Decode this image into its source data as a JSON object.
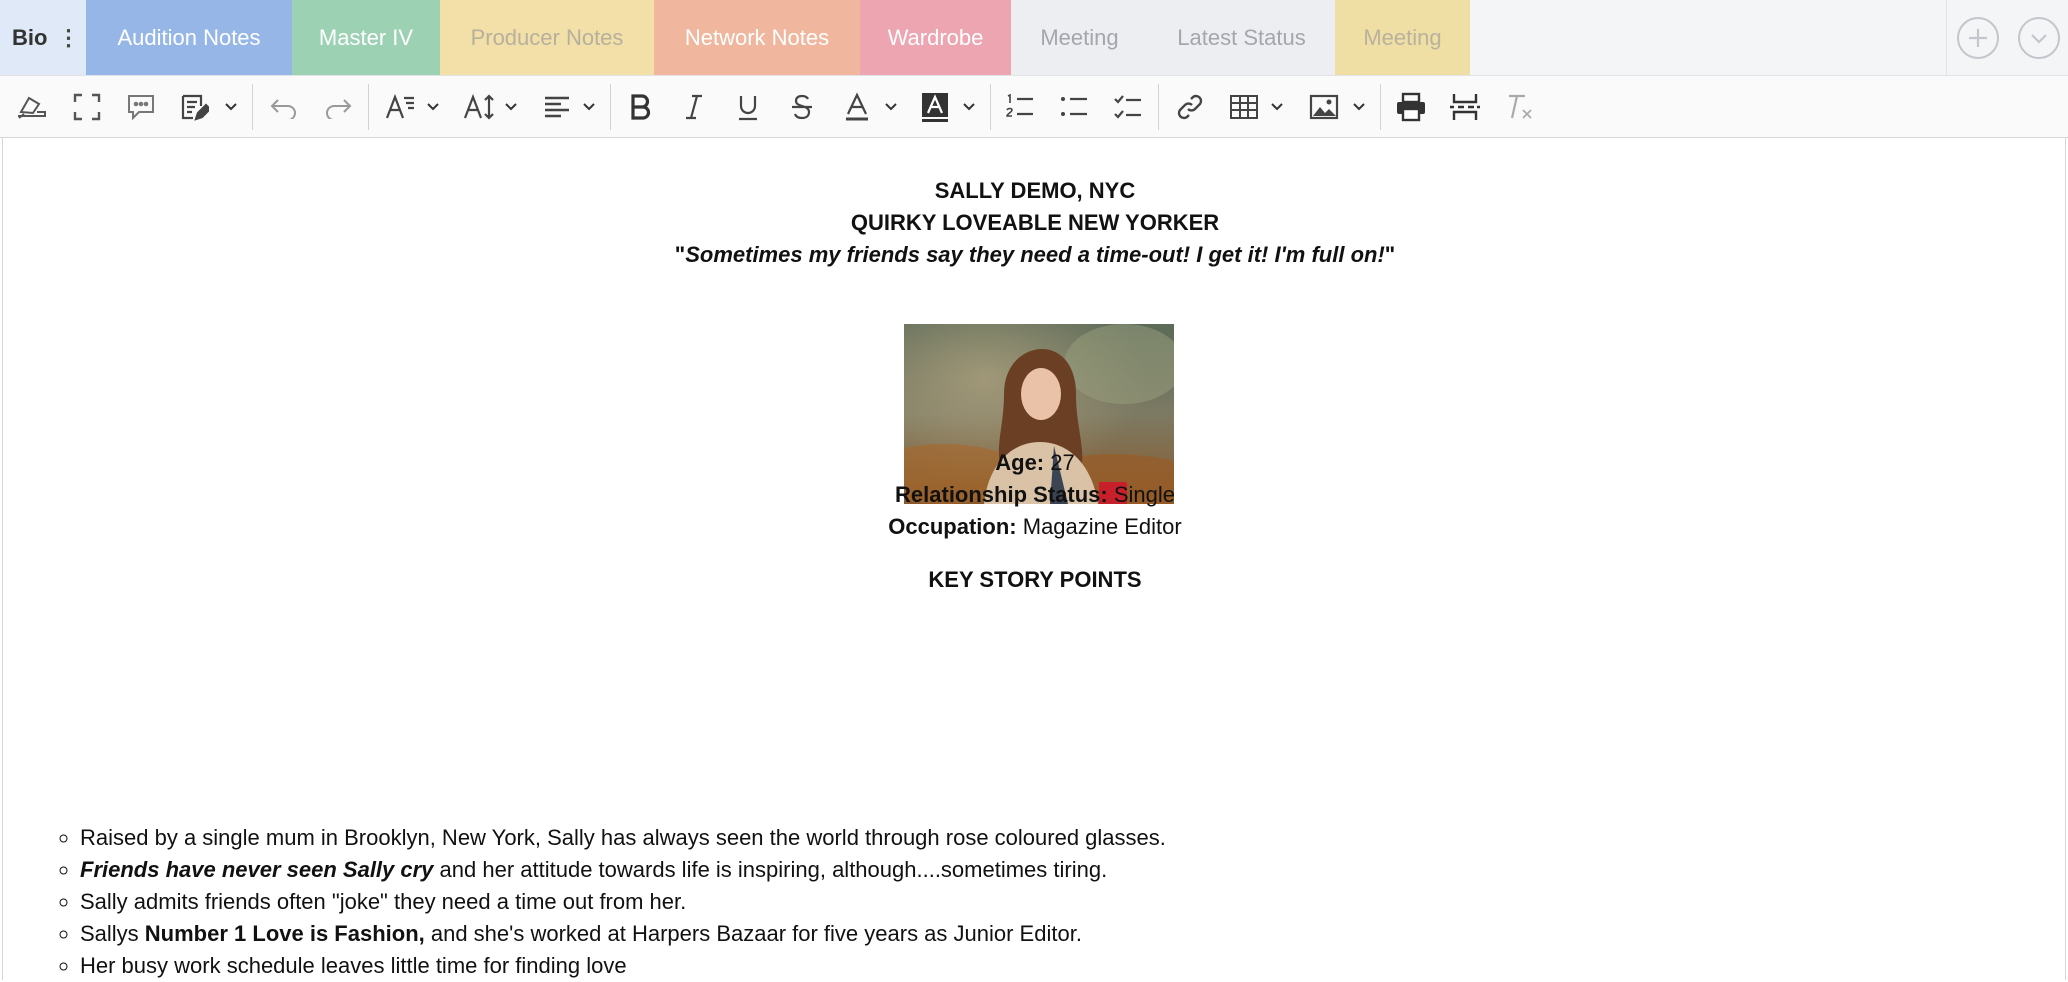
{
  "tabs": {
    "bio": "Bio",
    "bio_menu": "⋮",
    "items": [
      "Audition Notes",
      "Master IV",
      "Producer Notes",
      "Network Notes",
      "Wardrobe",
      "Meeting",
      "Latest Status",
      "Meeting"
    ]
  },
  "toolbar": {
    "icons": [
      "format-painter-icon",
      "fullscreen-icon",
      "comment-icon",
      "edit-mode-icon",
      "undo-icon",
      "redo-icon",
      "font-family-icon",
      "font-size-icon",
      "align-icon",
      "bold-icon",
      "italic-icon",
      "underline-icon",
      "strikethrough-icon",
      "text-color-icon",
      "highlight-color-icon",
      "numbered-list-icon",
      "bullet-list-icon",
      "checklist-icon",
      "link-icon",
      "table-icon",
      "image-icon",
      "print-icon",
      "page-break-icon",
      "clear-format-icon"
    ]
  },
  "document": {
    "name_line": "SALLY DEMO, NYC",
    "tagline": "QUIRKY LOVEABLE NEW YORKER",
    "quote_open": "\"",
    "quote_text": "Sometimes my friends say they need a time-out! I get it! I'm full on!",
    "quote_close": "\"",
    "facts": [
      {
        "label": "Age:",
        "value": " 27"
      },
      {
        "label": "Relationship Status:",
        "value": " Single"
      },
      {
        "label": "Occupation:",
        "value": " Magazine Editor"
      }
    ],
    "section_heading": "KEY STORY POINTS",
    "points": {
      "p1": "Raised by a single mum in Brooklyn, New York, Sally has always seen the world through rose coloured glasses.",
      "p2_strong": "Friends have never seen Sally cry",
      "p2_rest": " and her attitude towards life is inspiring, although....sometimes tiring.",
      "p3": "Sally admits friends often \"joke\" they need a time out from her.",
      "p4_pre": "Sallys ",
      "p4_strong": "Number 1 Love is Fashion,",
      "p4_rest": " and she's worked at Harpers Bazaar for five years as Junior Editor.",
      "p5": "Her busy work schedule leaves little time for finding love"
    }
  },
  "colors": {
    "audition": "#97b6e8",
    "master": "#9dd1b4",
    "producer": "#f2e0a8",
    "network": "#f0b69e",
    "wardrobe": "#eda5b2",
    "meeting": "#efdfa4"
  }
}
